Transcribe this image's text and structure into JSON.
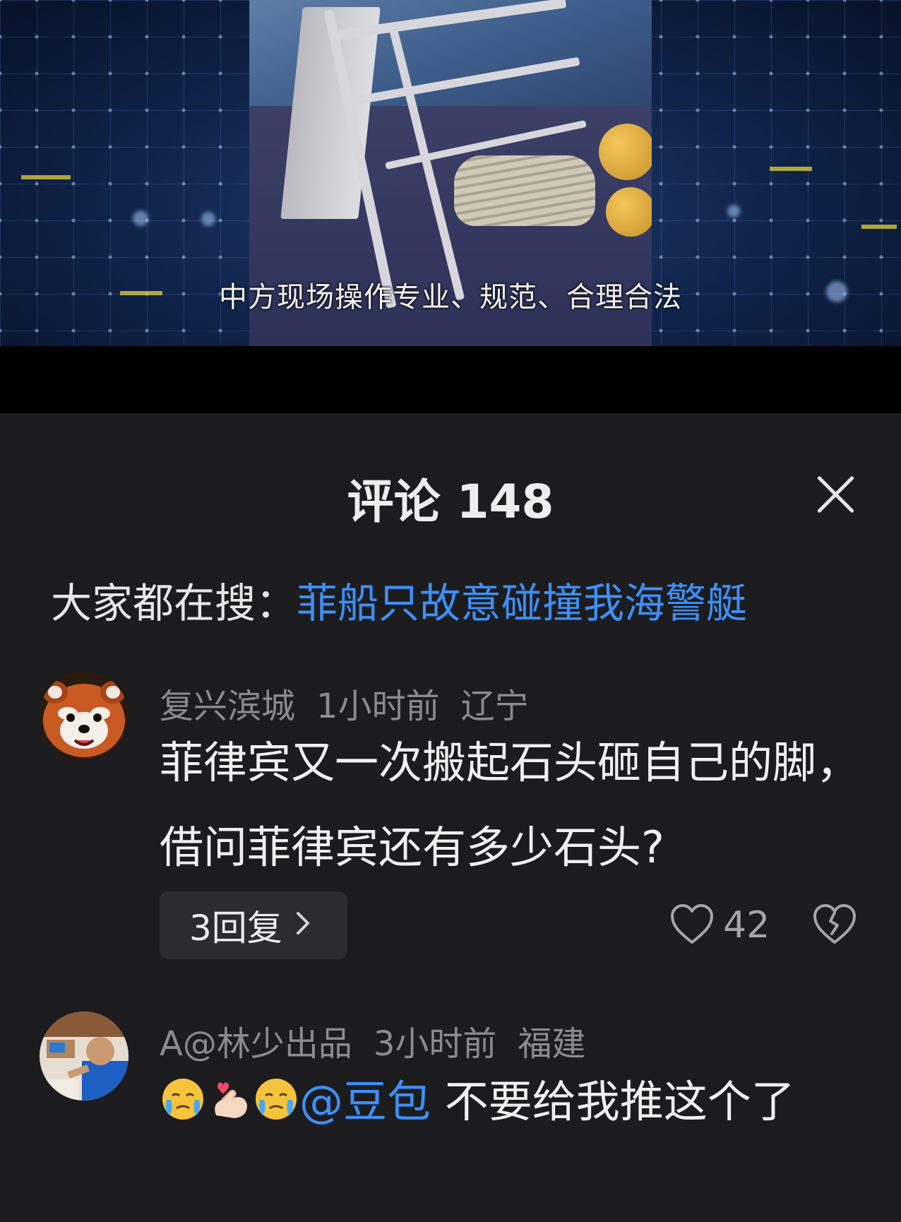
{
  "video": {
    "subtitle": "中方现场操作专业、规范、合理合法"
  },
  "comments_panel": {
    "title": "评论 148",
    "close_icon": "close-icon",
    "hot_search": {
      "label": "大家都在搜：",
      "term": "菲船只故意碰撞我海警艇"
    }
  },
  "comments": [
    {
      "username": "复兴滨城",
      "time": "1小时前",
      "location": "辽宁",
      "text": "菲律宾又一次搬起石头砸自己的脚，借问菲律宾还有多少石头?",
      "replies_label": "3回复",
      "like_count": "42",
      "avatar_icon": "red-panda-avatar"
    },
    {
      "username": "A@林少出品",
      "time": "3小时前",
      "location": "福建",
      "emojis": [
        "crying-face-emoji",
        "finger-heart-emoji",
        "crying-face-emoji"
      ],
      "mention": "@豆包",
      "text": " 不要给我推这个了",
      "avatar_icon": "person-photo-avatar"
    }
  ],
  "colors": {
    "background": "#1c1c1e",
    "link_blue": "#3d8ff6",
    "meta_gray": "#8b8b8f"
  }
}
